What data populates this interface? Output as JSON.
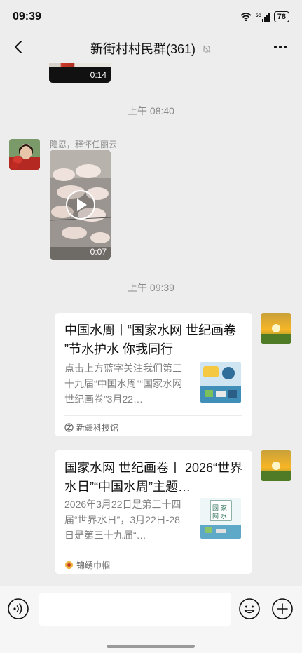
{
  "status": {
    "time": "09:39",
    "battery": "78"
  },
  "header": {
    "title": "新街村村民群(361)"
  },
  "messages": {
    "ts1": "上午 08:40",
    "ts2": "上午 09:39",
    "video1_duration": "0:14",
    "sender_name": "隐忍，释怀任丽云",
    "video2_duration": "0:07"
  },
  "cards": [
    {
      "title": "中国水周丨“国家水网 世纪画卷 ”节水护水 你我同行",
      "desc": "点击上方蓝字关注我们第三十九届“中国水周”“国家水网 世纪画卷”3月22…",
      "source": "新疆科技馆"
    },
    {
      "title": "国家水网 世纪画卷丨 2026“世界水日”“中国水周”主题…",
      "desc": "2026年3月22日是第三十四届“世界水日”，3月22日-28日是第三十九届“…",
      "source": "锦绣巾帼"
    }
  ],
  "icons": {
    "back": "chevron-left-icon",
    "mute": "bell-off-icon",
    "more": "more-dots-icon",
    "voice": "voice-icon",
    "emoji": "emoji-icon",
    "plus": "plus-icon"
  },
  "colors": {
    "background": "#ededed",
    "bubble": "#ffffff",
    "muted_text": "#8a8a8a"
  }
}
